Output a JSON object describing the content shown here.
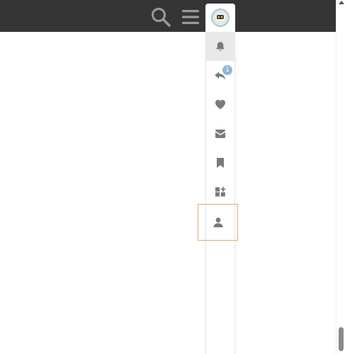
{
  "header": {
    "background": "#353535",
    "search_icon": "search-icon",
    "menu_icon": "hamburger-menu-icon",
    "avatar_icon": "robot-avatar"
  },
  "user_menu": {
    "tabs": [
      {
        "icon": "bell-icon",
        "active": true
      },
      {
        "icon": "reply-icon",
        "badge": "1"
      },
      {
        "icon": "heart-icon"
      },
      {
        "icon": "envelope-icon"
      },
      {
        "icon": "bookmark-icon"
      },
      {
        "icon": "widgets-plus-icon"
      },
      {
        "icon": "user-icon",
        "focused": true
      }
    ],
    "icon_color": "#7a7a7a",
    "active_background": "#e9e9e9",
    "badge_color": "#8fb8d6",
    "focus_color": "#e8a777"
  }
}
